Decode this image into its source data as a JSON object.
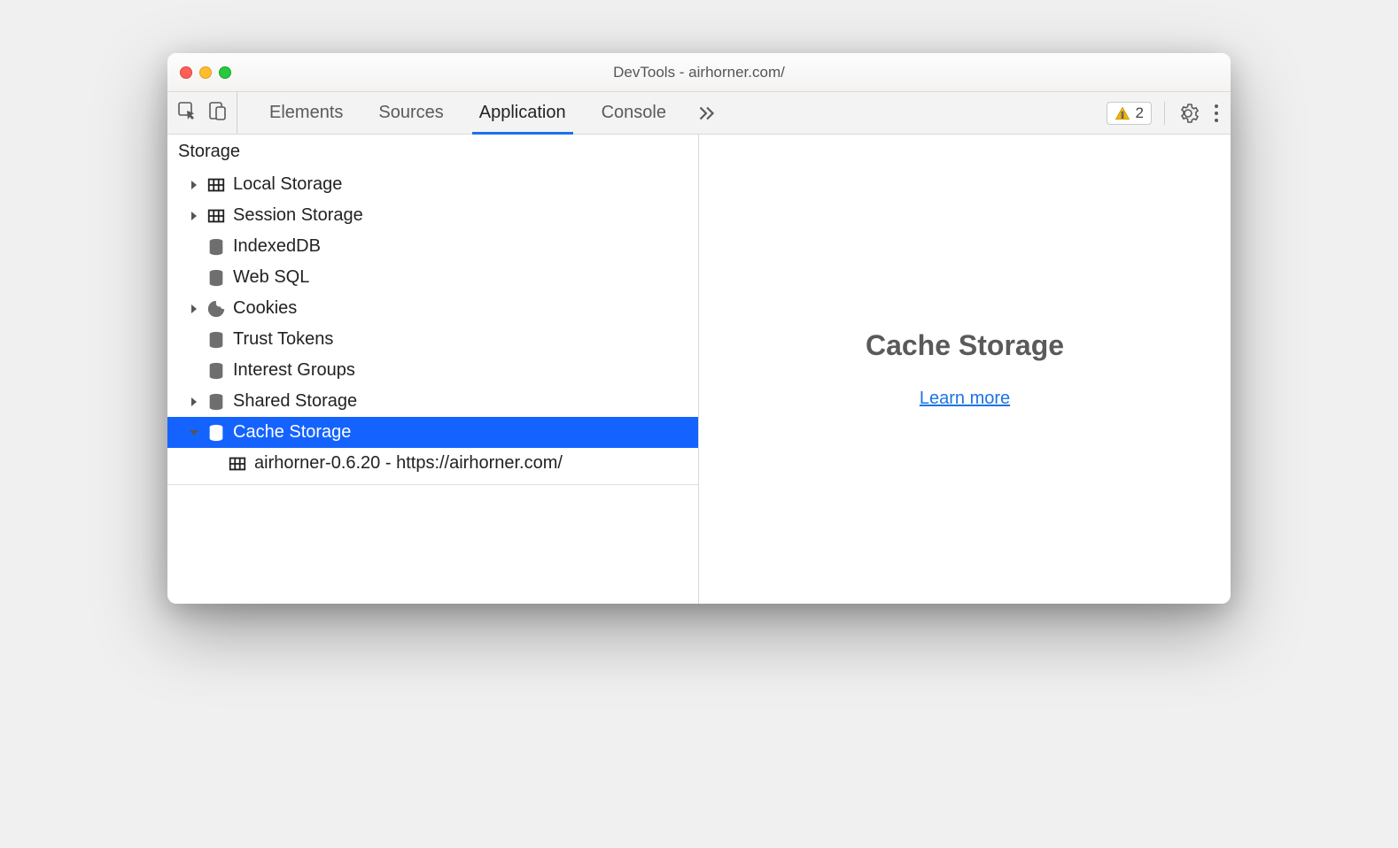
{
  "window": {
    "title": "DevTools - airhorner.com/"
  },
  "toolbar": {
    "tabs": [
      "Elements",
      "Sources",
      "Application",
      "Console"
    ],
    "active_tab_index": 2,
    "issues_count": "2"
  },
  "sidebar": {
    "section_title": "Storage",
    "items": [
      {
        "label": "Local Storage",
        "icon": "grid",
        "expandable": true,
        "expanded": false
      },
      {
        "label": "Session Storage",
        "icon": "grid",
        "expandable": true,
        "expanded": false
      },
      {
        "label": "IndexedDB",
        "icon": "database",
        "expandable": false
      },
      {
        "label": "Web SQL",
        "icon": "database",
        "expandable": false
      },
      {
        "label": "Cookies",
        "icon": "cookie",
        "expandable": true,
        "expanded": false
      },
      {
        "label": "Trust Tokens",
        "icon": "database",
        "expandable": false
      },
      {
        "label": "Interest Groups",
        "icon": "database",
        "expandable": false
      },
      {
        "label": "Shared Storage",
        "icon": "database",
        "expandable": true,
        "expanded": false
      },
      {
        "label": "Cache Storage",
        "icon": "database",
        "expandable": true,
        "expanded": true,
        "selected": true,
        "children": [
          {
            "label": "airhorner-0.6.20 - https://airhorner.com/",
            "icon": "grid"
          }
        ]
      }
    ]
  },
  "main": {
    "heading": "Cache Storage",
    "link_text": "Learn more"
  }
}
